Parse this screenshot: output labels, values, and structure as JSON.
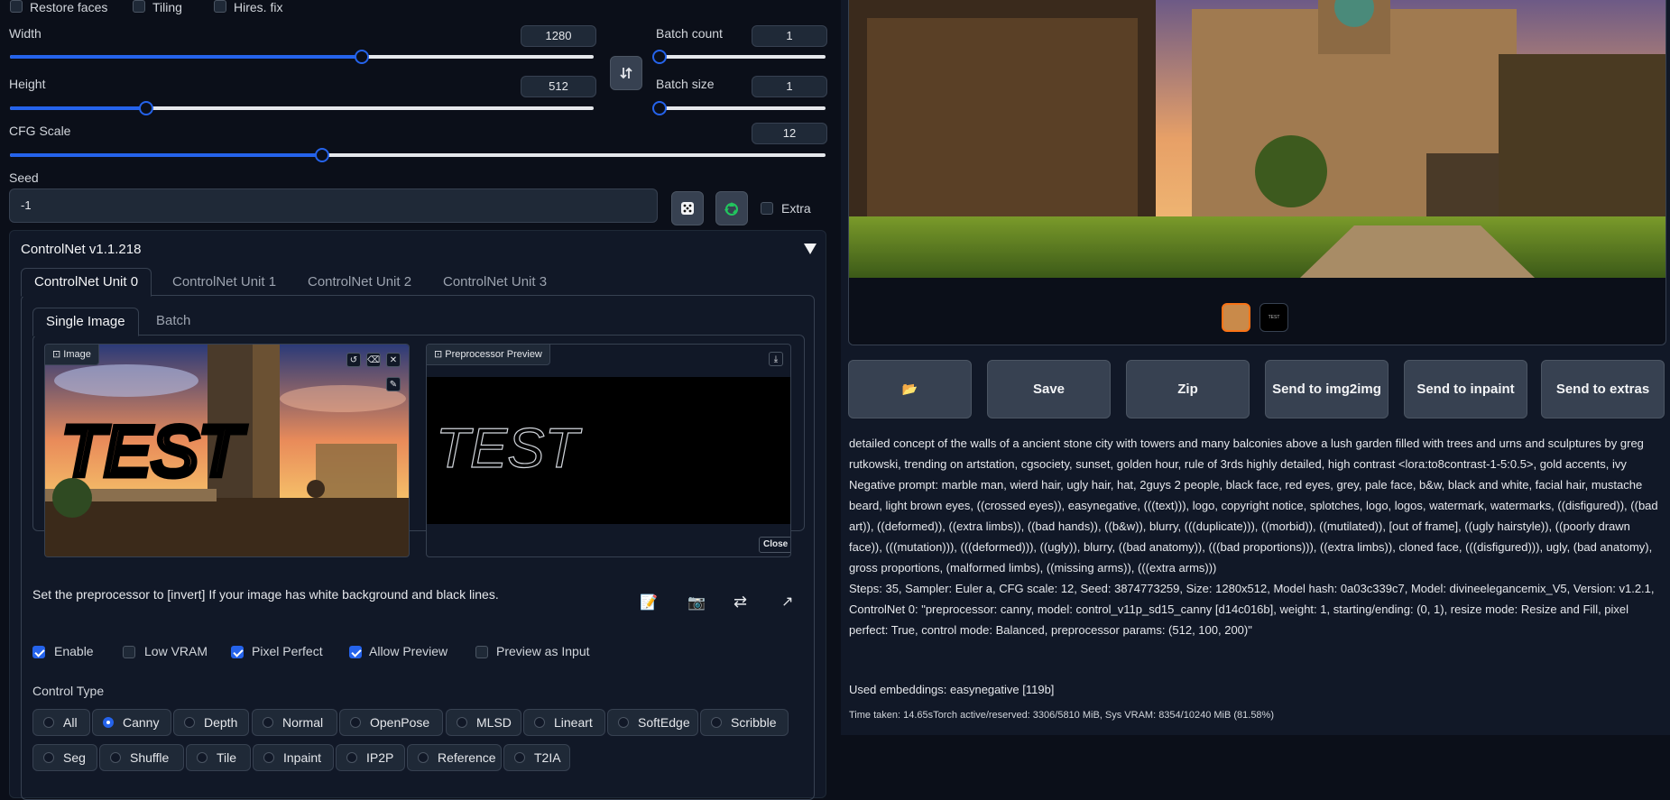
{
  "top_checks": [
    {
      "label": "Restore faces",
      "checked": false
    },
    {
      "label": "Tiling",
      "checked": false
    },
    {
      "label": "Hires. fix",
      "checked": false
    }
  ],
  "width": {
    "label": "Width",
    "value": "1280",
    "fraction": 0.6
  },
  "height": {
    "label": "Height",
    "value": "512",
    "fraction": 0.23
  },
  "batch_count": {
    "label": "Batch count",
    "value": "1",
    "fraction": 0.0
  },
  "batch_size": {
    "label": "Batch size",
    "value": "1",
    "fraction": 0.0
  },
  "cfg": {
    "label": "CFG Scale",
    "value": "12",
    "fraction": 0.38
  },
  "seed": {
    "label": "Seed",
    "value": "-1",
    "extra_label": "Extra"
  },
  "controlnet": {
    "title": "ControlNet v1.1.218",
    "units": [
      "ControlNet Unit 0",
      "ControlNet Unit 1",
      "ControlNet Unit 2",
      "ControlNet Unit 3"
    ],
    "subtabs": [
      "Single Image",
      "Batch"
    ],
    "image_label": "Image",
    "preview_label": "Preprocessor Preview",
    "canvas_text": "TEST",
    "close_label": "Close",
    "hint": "Set the preprocessor to [invert] If your image has white background and black lines.",
    "options": [
      {
        "label": "Enable",
        "checked": true
      },
      {
        "label": "Low VRAM",
        "checked": false
      },
      {
        "label": "Pixel Perfect",
        "checked": true
      },
      {
        "label": "Allow Preview",
        "checked": true
      },
      {
        "label": "Preview as Input",
        "checked": false
      }
    ],
    "control_type_label": "Control Type",
    "control_types_row1": [
      "All",
      "Canny",
      "Depth",
      "Normal",
      "OpenPose",
      "MLSD",
      "Lineart",
      "SoftEdge",
      "Scribble"
    ],
    "control_types_row2": [
      "Seg",
      "Shuffle",
      "Tile",
      "Inpaint",
      "IP2P",
      "Reference",
      "T2IA"
    ],
    "selected": "Canny"
  },
  "actions": {
    "folder_icon": "📂",
    "save": "Save",
    "zip": "Zip",
    "img2img": "Send to img2img",
    "inpaint": "Send to inpaint",
    "extras": "Send to extras"
  },
  "thumb_text": "TEST",
  "info": {
    "prompt": "detailed concept of the walls of a ancient stone city with towers and many balconies above a lush garden filled with trees and urns and sculptures by greg rutkowski, trending on artstation, cgsociety, sunset, golden hour, rule of 3rds highly detailed, high contrast <lora:to8contrast-1-5:0.5>, gold accents, ivy",
    "negative": "Negative prompt: marble man, wierd hair, ugly hair, hat, 2guys 2 people, black face, red eyes, grey, pale face, b&w, black and white, facial hair, mustache beard, light brown eyes, ((crossed eyes)), easynegative, (((text))), logo, copyright notice, splotches, logo, logos, watermark, watermarks, ((disfigured)), ((bad art)), ((deformed)), ((extra limbs)), ((bad hands)), ((b&w)), blurry, (((duplicate))), ((morbid)), ((mutilated)), [out of frame], ((ugly hairstyle)), ((poorly drawn face)), (((mutation))), (((deformed))), ((ugly)), blurry, ((bad anatomy)), (((bad proportions))), ((extra limbs)), cloned face, (((disfigured))), ugly, (bad anatomy), gross proportions, (malformed limbs), ((missing arms)), (((extra arms)))",
    "steps": "Steps: 35, Sampler: Euler a, CFG scale: 12, Seed: 3874773259, Size: 1280x512, Model hash: 0a03c339c7, Model: divineelegancemix_V5, Version: v1.2.1, ControlNet 0: \"preprocessor: canny, model: control_v11p_sd15_canny [d14c016b], weight: 1, starting/ending: (0, 1), resize mode: Resize and Fill, pixel perfect: True, control mode: Balanced, preprocessor params: (512, 100, 200)\"",
    "embeddings": "Used embeddings: easynegative [119b]",
    "time": "Time taken: 14.65sTorch active/reserved: 3306/5810 MiB, Sys VRAM: 8354/10240 MiB (81.58%)"
  }
}
